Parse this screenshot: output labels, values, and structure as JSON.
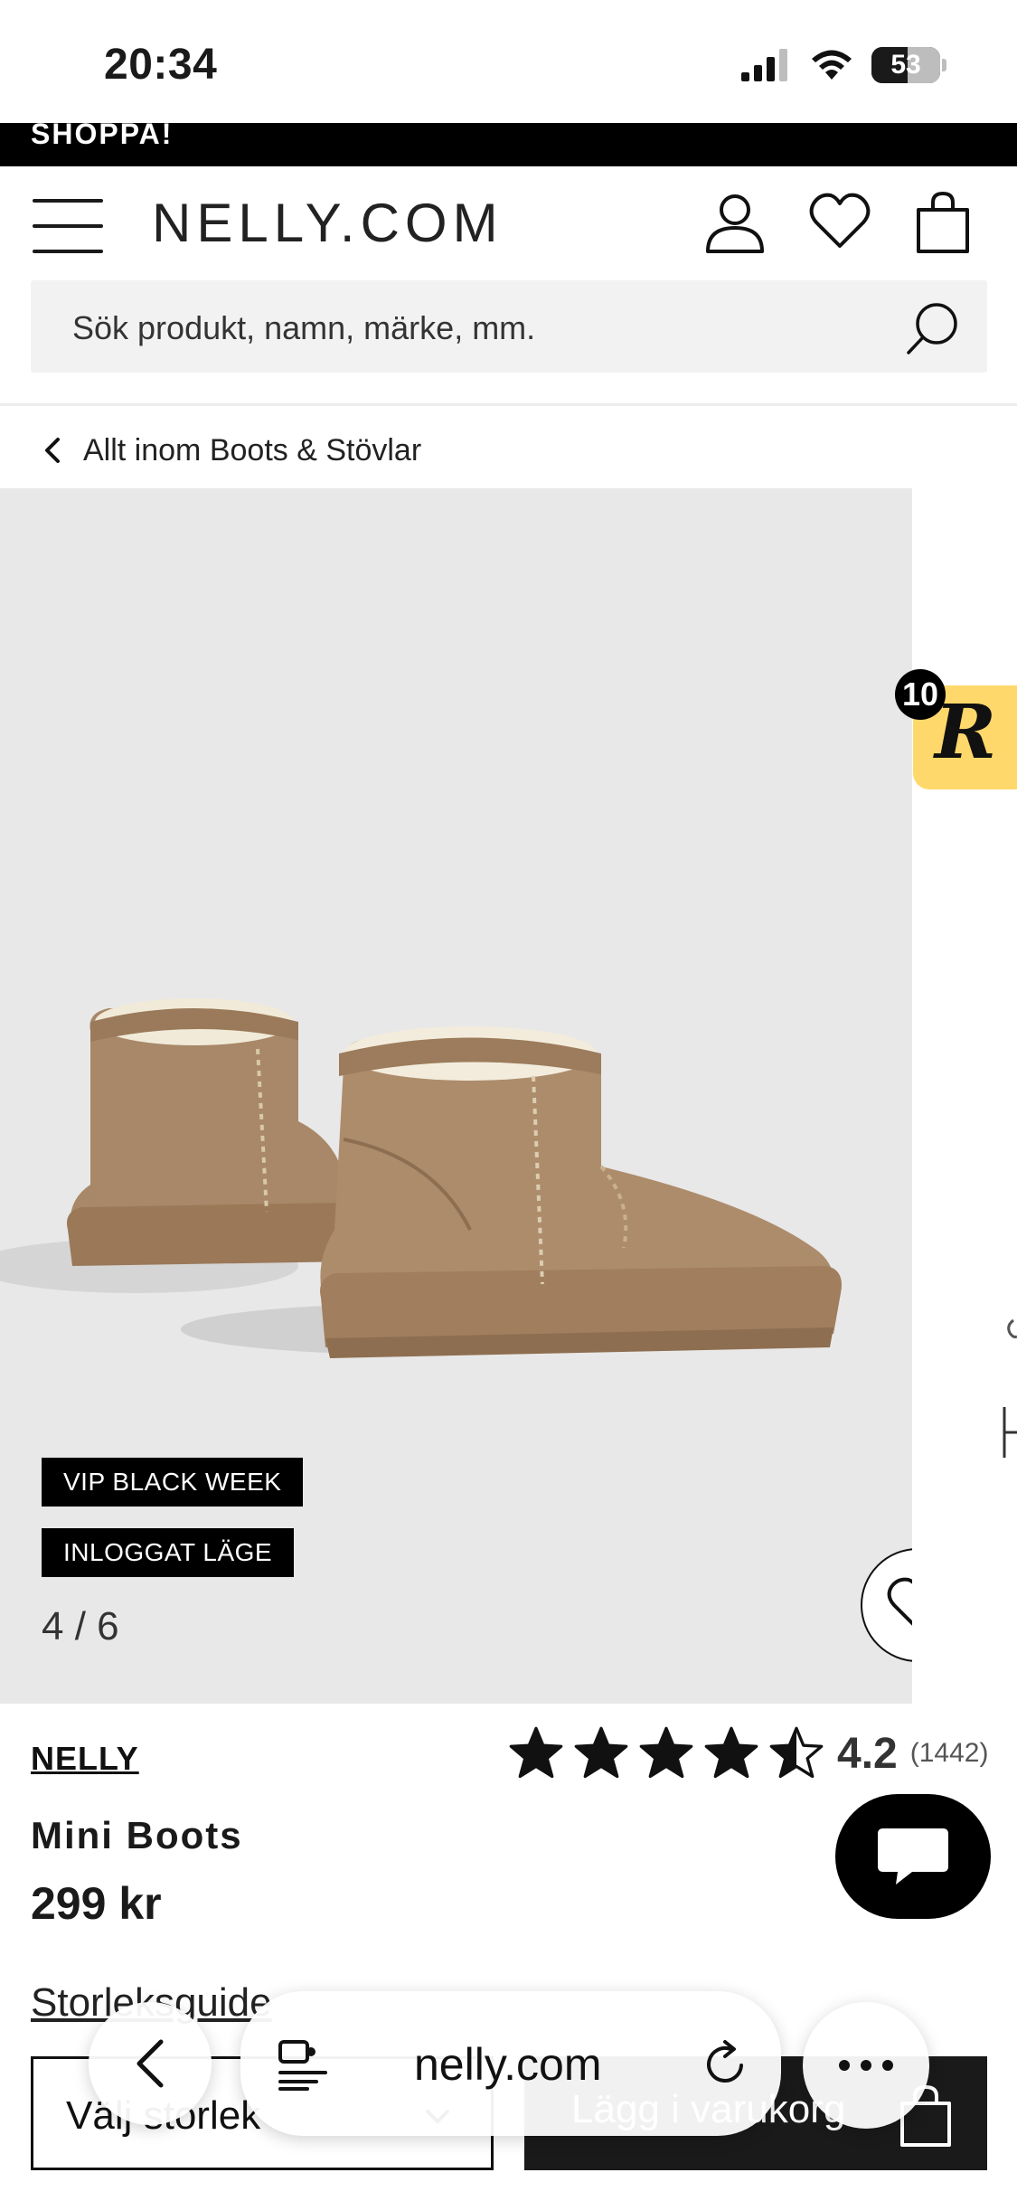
{
  "status_bar": {
    "time": "20:34",
    "battery": "53",
    "battery_fraction": 0.53
  },
  "promo": {
    "text": "SHOPPA!"
  },
  "header": {
    "logo": "NELLY.COM"
  },
  "search": {
    "placeholder": "Sök produkt, namn, märke, mm."
  },
  "breadcrumb": {
    "label": "Allt inom Boots & Stövlar"
  },
  "gallery": {
    "badges": [
      "VIP BLACK WEEK",
      "INLOGGAT LÄGE"
    ],
    "counter": "4 / 6"
  },
  "widget": {
    "letter": "R",
    "count": "10"
  },
  "product": {
    "brand": "NELLY",
    "rating": {
      "score": "4.2",
      "count": "(1442)",
      "stars_value": 4.2,
      "stars_max": 5
    },
    "title": "Mini Boots",
    "price": "299 kr",
    "size_guide": "Storleksguide",
    "size_select": "Välj storlek",
    "add_to_cart": "Lägg i varukorg"
  },
  "browser": {
    "url": "nelly.com"
  },
  "colors": {
    "accent": "#000000",
    "widget": "#ffd86b",
    "gallery_bg": "#e8e8e8",
    "boot": "#a88868"
  }
}
